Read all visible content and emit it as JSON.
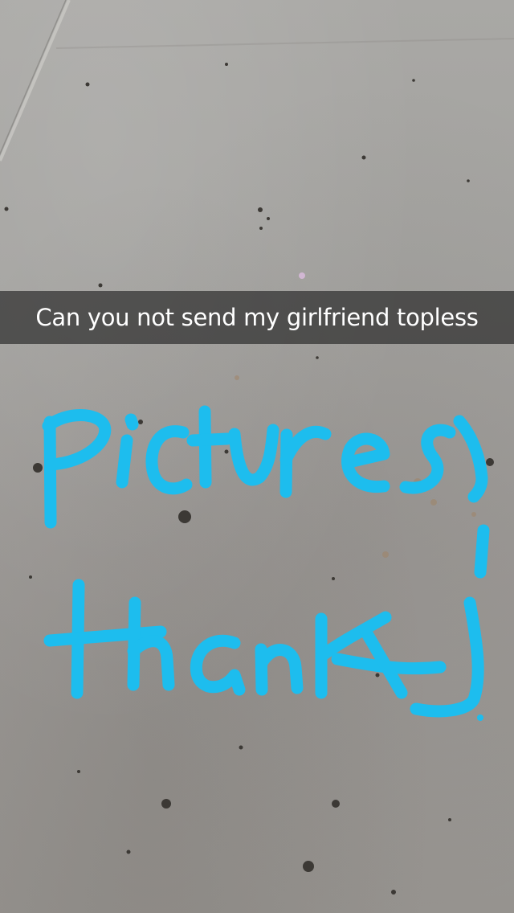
{
  "snap": {
    "caption": "Can you not send my girlfriend topless",
    "drawing": {
      "color": "#1dbdee",
      "line_1": "pictures",
      "line_2": "thanks"
    }
  }
}
